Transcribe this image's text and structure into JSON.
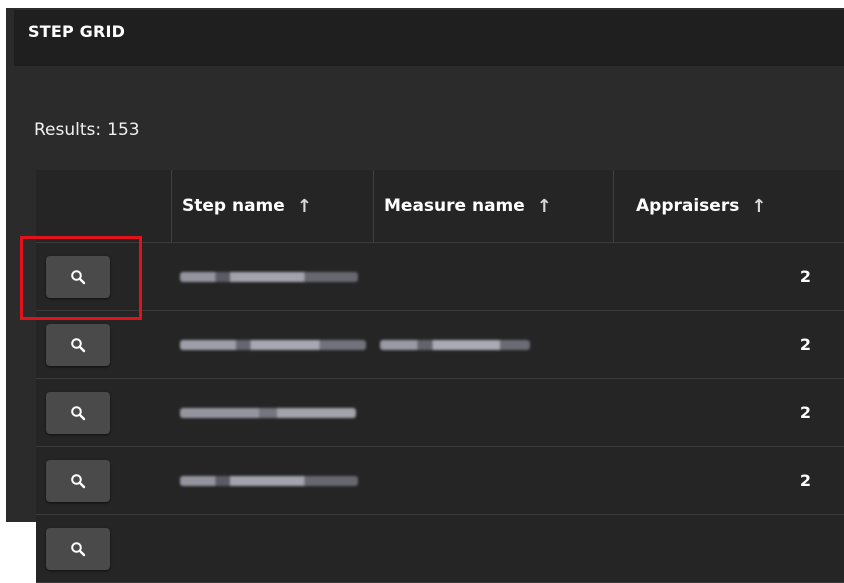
{
  "panel": {
    "title": "STEP GRID"
  },
  "results": {
    "label": "Results:",
    "count": "153"
  },
  "grid": {
    "columns": [
      {
        "label": "",
        "sort": ""
      },
      {
        "label": "Step name",
        "sort": "↑"
      },
      {
        "label": "Measure name",
        "sort": "↑"
      },
      {
        "label": "Appraisers",
        "sort": "↑"
      }
    ],
    "rows": [
      {
        "appraisers": "2"
      },
      {
        "appraisers": "2"
      },
      {
        "appraisers": "2"
      },
      {
        "appraisers": "2"
      }
    ]
  },
  "icons": {
    "row_action": "search-icon"
  },
  "colors": {
    "highlight": "#e0121b",
    "panel_bg": "#2b2b2b",
    "button_bg": "#4a4a4a"
  }
}
